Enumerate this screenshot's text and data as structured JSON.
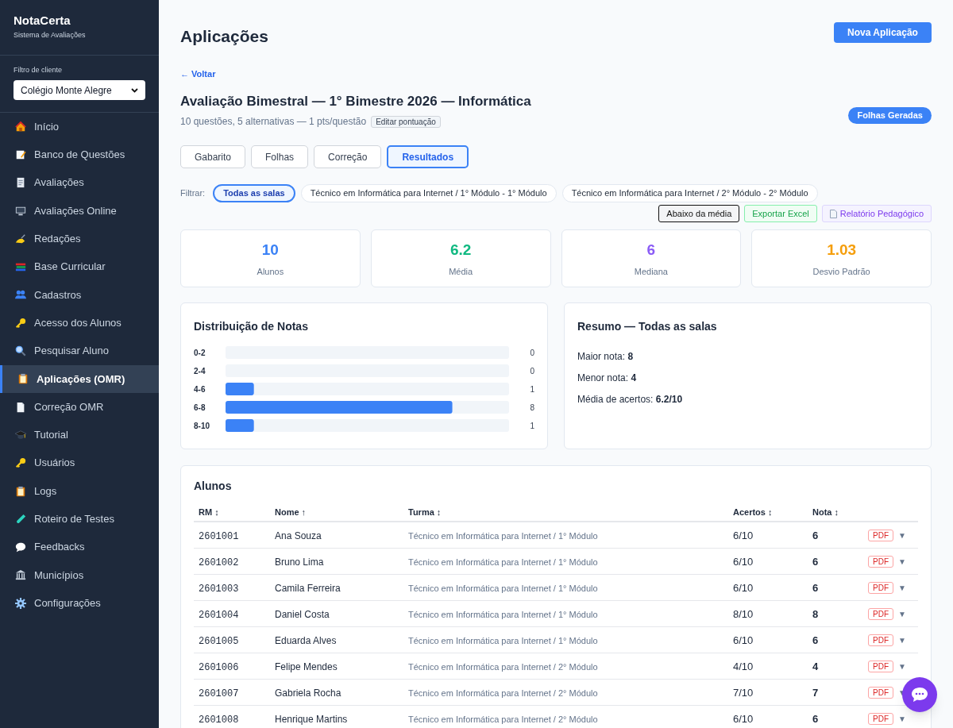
{
  "brand": {
    "name": "NotaCerta",
    "subtitle": "Sistema de Avaliações"
  },
  "client_filter": {
    "label": "Filtro de cliente",
    "value": "Colégio Monte Alegre"
  },
  "sidebar": {
    "items": [
      {
        "label": "Início",
        "selected": false
      },
      {
        "label": "Banco de Questões",
        "selected": false
      },
      {
        "label": "Avaliações",
        "selected": false
      },
      {
        "label": "Avaliações Online",
        "selected": false
      },
      {
        "label": "Redações",
        "selected": false
      },
      {
        "label": "Base Curricular",
        "selected": false
      },
      {
        "label": "Cadastros",
        "selected": false
      },
      {
        "label": "Acesso dos Alunos",
        "selected": false
      },
      {
        "label": "Pesquisar Aluno",
        "selected": false
      },
      {
        "label": "Aplicações (OMR)",
        "selected": true
      },
      {
        "label": "Correção OMR",
        "selected": false
      },
      {
        "label": "Tutorial",
        "selected": false
      },
      {
        "label": "Usuários",
        "selected": false
      },
      {
        "label": "Logs",
        "selected": false
      },
      {
        "label": "Roteiro de Testes",
        "selected": false
      },
      {
        "label": "Feedbacks",
        "selected": false
      },
      {
        "label": "Municípios",
        "selected": false
      },
      {
        "label": "Configurações",
        "selected": false
      }
    ]
  },
  "page_title": "Aplicações",
  "new_button": "Nova Aplicação",
  "back_link": "← Voltar",
  "exam": {
    "title": "Avaliação Bimestral — 1° Bimestre 2026 — Informática",
    "details": "10 questões, 5 alternativas — 1 pts/questão",
    "edit_button": "Editar pontuação",
    "status_badge": "Folhas Geradas"
  },
  "tabs": [
    {
      "label": "Gabarito",
      "selected": false
    },
    {
      "label": "Folhas",
      "selected": false
    },
    {
      "label": "Correção",
      "selected": false
    },
    {
      "label": "Resultados",
      "selected": true
    }
  ],
  "filter": {
    "label": "Filtrar:",
    "chips": [
      {
        "label": "Todas as salas",
        "selected": true
      },
      {
        "label": "Técnico em Informática para Internet / 1° Módulo - 1° Módulo",
        "selected": false
      },
      {
        "label": "Técnico em Informática para Internet / 2° Módulo - 2° Módulo",
        "selected": false
      }
    ]
  },
  "actions": [
    {
      "kind": "filter",
      "label": "Abaixo da média"
    },
    {
      "kind": "excel",
      "label": "Exportar Excel"
    },
    {
      "kind": "report",
      "label": "Relatório Pedagógico"
    }
  ],
  "stats": [
    {
      "value": "10",
      "label": "Alunos",
      "color": "#3b82f6"
    },
    {
      "value": "6.2",
      "label": "Média",
      "color": "#10b981"
    },
    {
      "value": "6",
      "label": "Mediana",
      "color": "#8b5cf6"
    },
    {
      "value": "1.03",
      "label": "Desvio Padrão",
      "color": "#f59e0b"
    }
  ],
  "distribution": {
    "title": "Distribuição de Notas",
    "chart_data": {
      "type": "bar",
      "orientation": "horizontal",
      "categories": [
        "0-2",
        "2-4",
        "4-6",
        "6-8",
        "8-10"
      ],
      "values": [
        0,
        0,
        1,
        8,
        1
      ],
      "value_labels": [
        "0",
        "0",
        "1",
        "8",
        "1"
      ]
    }
  },
  "summary": {
    "title": "Resumo — Todas as salas",
    "lines": [
      "Maior nota: **8**",
      "Menor nota: **4**",
      "Média de acertos: **6.2/10**"
    ]
  },
  "students": {
    "title": "Alunos",
    "columns": [
      "RM ↕",
      "Nome ↑",
      "Turma ↕",
      "Acertos ↕",
      "Nota ↕"
    ],
    "menu_glyph": "▼",
    "rows": [
      {
        "rm": "2601001",
        "name": "Ana Souza",
        "class": "Técnico em Informática para Internet / 1° Módulo",
        "hits": "6/10",
        "grade": "6",
        "pdf": "PDF"
      },
      {
        "rm": "2601002",
        "name": "Bruno Lima",
        "class": "Técnico em Informática para Internet / 1° Módulo",
        "hits": "6/10",
        "grade": "6",
        "pdf": "PDF"
      },
      {
        "rm": "2601003",
        "name": "Camila Ferreira",
        "class": "Técnico em Informática para Internet / 1° Módulo",
        "hits": "6/10",
        "grade": "6",
        "pdf": "PDF"
      },
      {
        "rm": "2601004",
        "name": "Daniel Costa",
        "class": "Técnico em Informática para Internet / 1° Módulo",
        "hits": "8/10",
        "grade": "8",
        "pdf": "PDF"
      },
      {
        "rm": "2601005",
        "name": "Eduarda Alves",
        "class": "Técnico em Informática para Internet / 1° Módulo",
        "hits": "6/10",
        "grade": "6",
        "pdf": "PDF"
      },
      {
        "rm": "2601006",
        "name": "Felipe Mendes",
        "class": "Técnico em Informática para Internet / 2° Módulo",
        "hits": "4/10",
        "grade": "4",
        "pdf": "PDF"
      },
      {
        "rm": "2601007",
        "name": "Gabriela Rocha",
        "class": "Técnico em Informática para Internet / 2° Módulo",
        "hits": "7/10",
        "grade": "7",
        "pdf": "PDF"
      },
      {
        "rm": "2601008",
        "name": "Henrique Martins",
        "class": "Técnico em Informática para Internet / 2° Módulo",
        "hits": "6/10",
        "grade": "6",
        "pdf": "PDF"
      }
    ]
  }
}
